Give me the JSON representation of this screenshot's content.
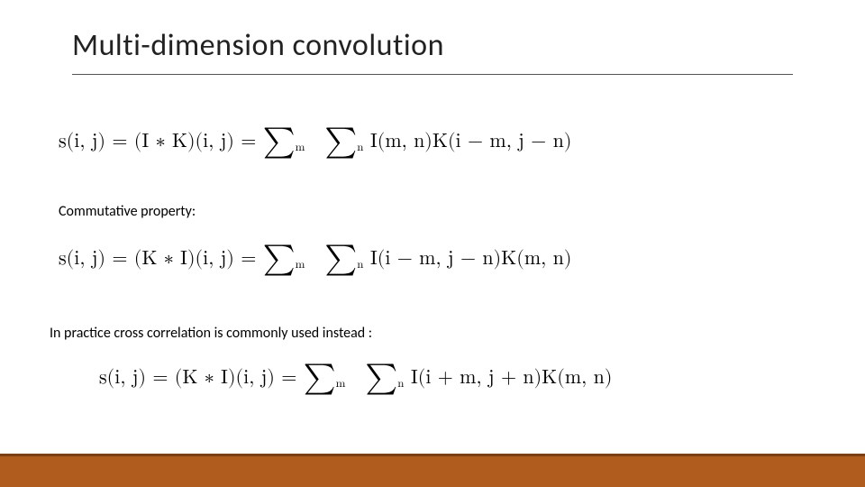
{
  "title": "Multi-dimension convolution",
  "labels": {
    "commutative": "Commutative property:",
    "cross_corr": "In practice cross correlation is commonly used instead :"
  },
  "equations": {
    "eq1": {
      "lhs": "s(i, j) = (I ∗ K)(i, j) = ",
      "sum1_sub": "m",
      "sum2_sub": "n",
      "rhs": " I(m, n)K(i − m, j − n)"
    },
    "eq2": {
      "lhs": "s(i, j) = (K ∗ I)(i, j) = ",
      "sum1_sub": "m",
      "sum2_sub": "n",
      "rhs": " I(i − m, j − n)K(m, n)"
    },
    "eq3": {
      "lhs": "s(i, j) = (K ∗ I)(i, j) = ",
      "sum1_sub": "m",
      "sum2_sub": "n",
      "rhs": " I(i + m, j + n)K(m, n)"
    }
  }
}
